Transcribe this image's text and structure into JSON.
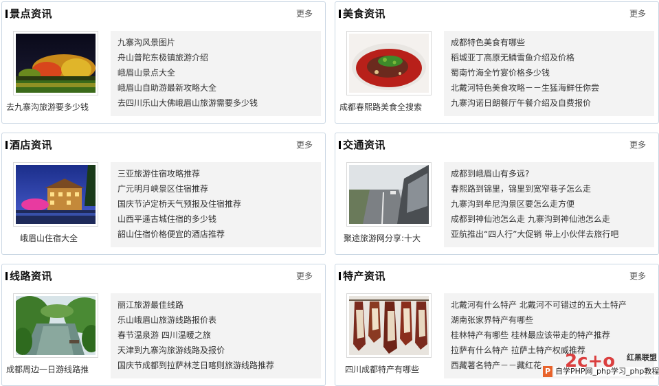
{
  "more_label": "更多",
  "panels": [
    {
      "title": "景点资讯",
      "caption": "去九寨沟旅游要多少钱",
      "thumb_icon": "autumn-forest-lake-photo",
      "items": [
        "九寨沟风景图片",
        "舟山普陀东极镇旅游介绍",
        "峨眉山景点大全",
        "峨眉山自助游最新攻略大全",
        "去四川乐山大佛峨眉山旅游需要多少钱"
      ]
    },
    {
      "title": "美食资讯",
      "caption": "成都春熙路美食全搜索",
      "thumb_icon": "spicy-fish-dish-photo",
      "items": [
        "成都特色美食有哪些",
        "稻城亚丁高原无鳞雪鱼介绍及价格",
        "蜀南竹海全竹宴价格多少钱",
        "北戴河特色美食攻略－－生猛海鲜任你尝",
        "九寨沟诺日朗餐厅午餐介绍及自费报价"
      ]
    },
    {
      "title": "酒店资讯",
      "caption": "峨眉山住宿大全",
      "thumb_icon": "hotel-night-photo",
      "items": [
        "三亚旅游住宿攻略推荐",
        "广元明月峡景区住宿推荐",
        "国庆节泸定桥天气预报及住宿推荐",
        "山西平遥古城住宿的多少钱",
        "韶山住宿价格便宜的酒店推荐"
      ]
    },
    {
      "title": "交通资讯",
      "caption": "聚途旅游网分享:十大",
      "thumb_icon": "highway-car-photo",
      "items": [
        "成都到峨眉山有多远?",
        "春熙路到锦里，锦里到宽窄巷子怎么走",
        "九寨沟到牟尼沟景区要怎么走方便",
        "成都到神仙池怎么走 九寨沟到神仙池怎么走",
        "亚航推出“四人行”大促销 带上小伙伴去旅行吧"
      ]
    },
    {
      "title": "线路资讯",
      "caption": "成都周边一日游线路推",
      "thumb_icon": "river-valley-photo",
      "items": [
        "丽江旅游最佳线路",
        "乐山峨眉山旅游线路报价表",
        "春节温泉游 四川温暖之旅",
        "天津到九寨沟旅游线路及报价",
        "国庆节成都到拉萨林芝日喀则旅游线路推荐"
      ]
    },
    {
      "title": "特产资讯",
      "caption": "四川成都特产有哪些",
      "thumb_icon": "cured-meat-photo",
      "items": [
        "北戴河有什么特产 北戴河不可错过的五大土特产",
        "湖南张家界特产有哪些",
        "桂林特产有哪些 桂林最应该带走的特产推荐",
        "拉萨有什么特产 拉萨土特产权威推荐",
        "西藏著名特产－－藏红花"
      ]
    }
  ],
  "watermark": {
    "logo_text": "红黑联盟",
    "footer_text": "自学PHP网_php学习_php教程",
    "p_icon": "P"
  }
}
